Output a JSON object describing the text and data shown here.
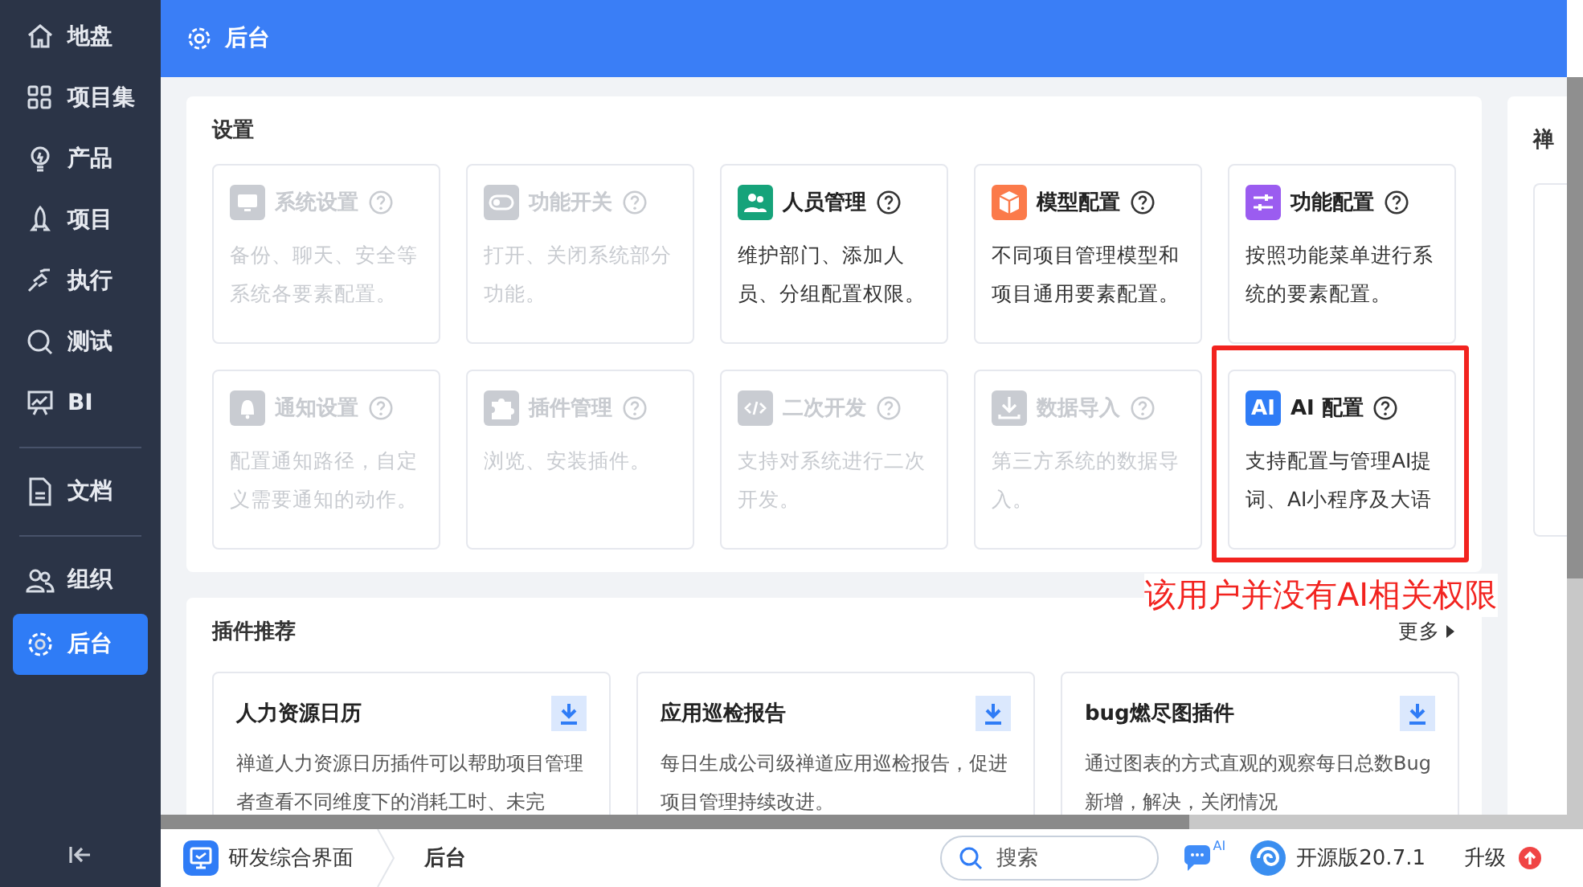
{
  "sidebar": {
    "groups": [
      [
        {
          "label": "地盘",
          "selected": false
        },
        {
          "label": "项目集",
          "selected": false
        },
        {
          "label": "产品",
          "selected": false
        },
        {
          "label": "项目",
          "selected": false
        },
        {
          "label": "执行",
          "selected": false
        },
        {
          "label": "测试",
          "selected": false
        },
        {
          "label": "BI",
          "selected": false
        }
      ],
      [
        {
          "label": "文档",
          "selected": false
        }
      ],
      [
        {
          "label": "组织",
          "selected": false
        },
        {
          "label": "后台",
          "selected": true
        }
      ]
    ]
  },
  "header": {
    "title": "后台"
  },
  "settings": {
    "title": "设置",
    "cards": [
      {
        "title": "系统设置",
        "description": "备份、聊天、安全等系统各要素配置。",
        "disabled": true,
        "color": "#c9ccd2"
      },
      {
        "title": "功能开关",
        "description": "打开、关闭系统部分功能。",
        "disabled": true,
        "color": "#c9ccd2"
      },
      {
        "title": "人员管理",
        "description": "维护部门、添加人员、分组配置权限。",
        "disabled": false,
        "color": "#16a37a"
      },
      {
        "title": "模型配置",
        "description": "不同项目管理模型和项目通用要素配置。",
        "disabled": false,
        "color": "#fb7a4a"
      },
      {
        "title": "功能配置",
        "description": "按照功能菜单进行系统的要素配置。",
        "disabled": false,
        "color": "#9b5cf0"
      },
      {
        "title": "通知设置",
        "description": "配置通知路径，自定义需要通知的动作。",
        "disabled": true,
        "color": "#c9ccd2"
      },
      {
        "title": "插件管理",
        "description": "浏览、安装插件。",
        "disabled": true,
        "color": "#c9ccd2"
      },
      {
        "title": "二次开发",
        "description": "支持对系统进行二次开发。",
        "disabled": true,
        "color": "#c9ccd2"
      },
      {
        "title": "数据导入",
        "description": "第三方系统的数据导入。",
        "disabled": true,
        "color": "#c9ccd2"
      },
      {
        "title": "AI 配置",
        "description": "支持配置与管理AI提词、AI小程序及大语",
        "disabled": false,
        "color": "#2f7cf6",
        "icon_text": "AI"
      }
    ]
  },
  "annotation": {
    "text": "该用户并没有AI相关权限"
  },
  "plugins": {
    "title": "插件推荐",
    "more": "更多",
    "items": [
      {
        "title": "人力资源日历",
        "description": "禅道人力资源日历插件可以帮助项目管理者查看不同维度下的消耗工时、未完"
      },
      {
        "title": "应用巡检报告",
        "description": "每日生成公司级禅道应用巡检报告，促进项目管理持续改进。"
      },
      {
        "title": "bug燃尽图插件",
        "description": "通过图表的方式直观的观察每日总数Bug新增，解决，关闭情况"
      }
    ]
  },
  "side_panel": {
    "title": "禅"
  },
  "status_bar": {
    "app": "研发综合界面",
    "crumb": "后台",
    "search": {
      "placeholder": "搜索"
    },
    "ai_badge": "AI",
    "version": "开源版20.7.1",
    "upgrade": "升级"
  }
}
